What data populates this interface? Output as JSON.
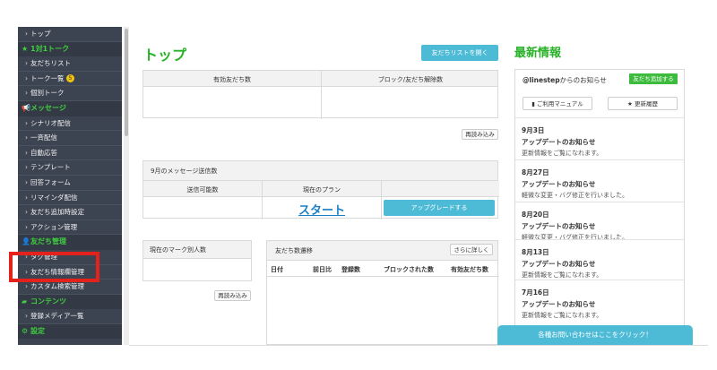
{
  "sidebar": {
    "items": [
      {
        "type": "item",
        "label": "トップ"
      },
      {
        "type": "section",
        "icon": "star-icon",
        "icon_glyph": "★",
        "label": "1対1トーク"
      },
      {
        "type": "item",
        "label": "友だちリスト"
      },
      {
        "type": "item",
        "label": "トーク一覧",
        "badge": "5"
      },
      {
        "type": "item",
        "label": "個別トーク"
      },
      {
        "type": "section",
        "icon": "megaphone-icon",
        "icon_glyph": "📢",
        "label": "メッセージ"
      },
      {
        "type": "item",
        "label": "シナリオ配信"
      },
      {
        "type": "item",
        "label": "一斉配信"
      },
      {
        "type": "item",
        "label": "自動応答"
      },
      {
        "type": "item",
        "label": "テンプレート"
      },
      {
        "type": "item",
        "label": "回答フォーム"
      },
      {
        "type": "item",
        "label": "リマインダ配信"
      },
      {
        "type": "item",
        "label": "友だち追加時設定"
      },
      {
        "type": "item",
        "label": "アクション管理"
      },
      {
        "type": "section",
        "icon": "person-icon",
        "icon_glyph": "👤",
        "label": "友だち管理"
      },
      {
        "type": "item",
        "label": "タグ管理"
      },
      {
        "type": "item",
        "label": "友だち情報欄管理"
      },
      {
        "type": "item",
        "label": "カスタム検索管理"
      },
      {
        "type": "section",
        "icon": "folder-icon",
        "icon_glyph": "▰",
        "label": "コンテンツ"
      },
      {
        "type": "item",
        "label": "登録メディア一覧"
      },
      {
        "type": "section",
        "icon": "gear-icon",
        "icon_glyph": "⚙",
        "label": "設定"
      }
    ]
  },
  "main": {
    "title": "トップ",
    "friends_list_button": "友だちリストを開く",
    "friends_panel": {
      "col1": "有効友だち数",
      "col2": "ブロック/友だち解除数",
      "reload": "再読み込み"
    },
    "message_panel": {
      "title": "9月のメッセージ送信数",
      "col1": "送信可能数",
      "col2": "現在のプラン",
      "plan": "スタート",
      "upgrade": "アップグレードする"
    },
    "mark_panel": {
      "title": "現在のマーク別人数",
      "reload": "再読み込み"
    },
    "trend_panel": {
      "title": "友だち数遷移",
      "detail": "さらに詳しく",
      "columns": [
        "日付",
        "前日比",
        "登録数",
        "ブロックされた数",
        "有効友だち数"
      ]
    }
  },
  "news": {
    "title": "最新情報",
    "account": "@linestep",
    "account_suffix": "からのお知らせ",
    "add_friend": "友だち追加する",
    "manual": "ご利用マニュアル",
    "history": "更新履歴",
    "items": [
      {
        "date": "9月3日",
        "title": "アップデートのお知らせ",
        "text": "更新情報をご覧になれます。"
      },
      {
        "date": "8月27日",
        "title": "アップデートのお知らせ",
        "text": "軽微な変更・バグ修正を行いました。"
      },
      {
        "date": "8月20日",
        "title": "アップデートのお知らせ",
        "text": "軽微な変更・バグ修正を行いました。"
      },
      {
        "date": "8月13日",
        "title": "アップデートのお知らせ",
        "text": "更新情報をご覧になれます。"
      },
      {
        "date": "7月16日",
        "title": "アップデートのお知らせ",
        "text": "更新情報をご覧になれます。"
      }
    ]
  },
  "contact": "各種お問い合わせはここをクリック！",
  "colors": {
    "accent_green": "#27b227",
    "button_blue": "#4dbbd6",
    "sidebar_bg": "#3d4451",
    "highlight_red": "#e4211b"
  }
}
